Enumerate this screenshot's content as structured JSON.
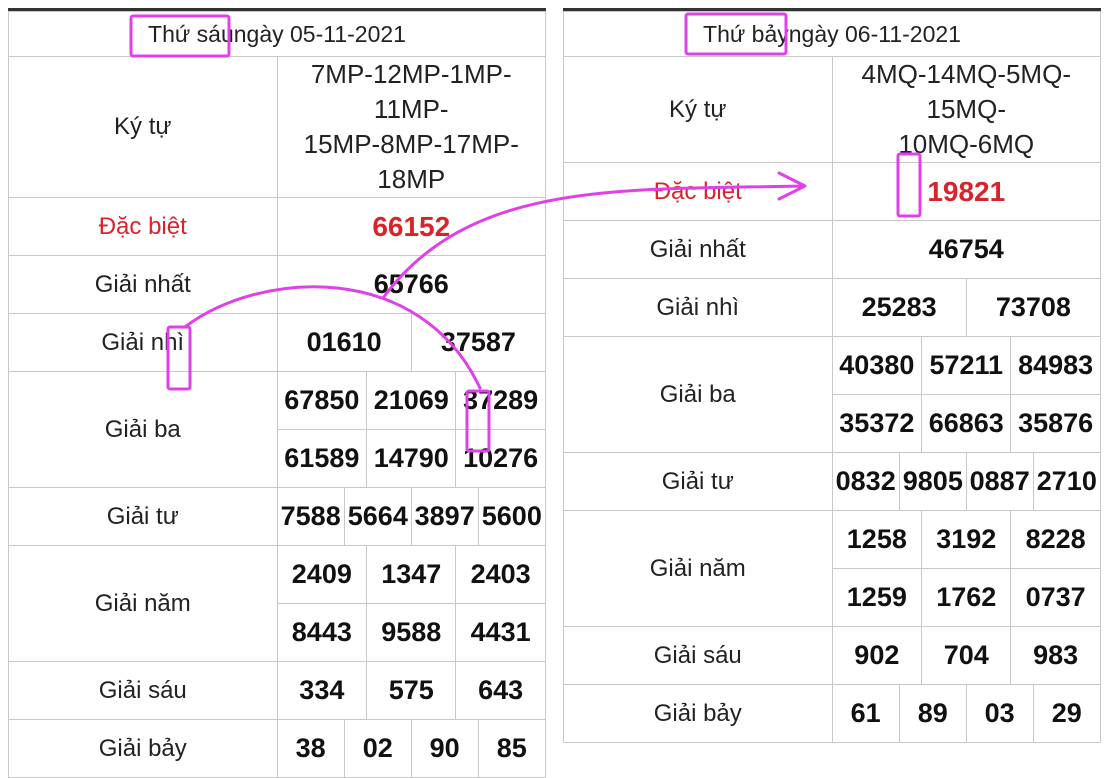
{
  "left": {
    "header": {
      "day": "Thứ sáu",
      "date_text": "ngày 05-11-2021"
    },
    "ky_tu_label": "Ký tự",
    "ky_tu_line1": "7MP-12MP-1MP-11MP-",
    "ky_tu_line2": "15MP-8MP-17MP-18MP",
    "dac_biet_label": "Đặc biệt",
    "dac_biet": "66152",
    "nhat_label": "Giải nhất",
    "nhat": "65766",
    "nhi_label": "Giải nhì",
    "nhi": [
      "01610",
      "37587"
    ],
    "ba_label": "Giải ba",
    "ba": [
      "67850",
      "21069",
      "37289",
      "61589",
      "14790",
      "10276"
    ],
    "tu_label": "Giải tư",
    "tu": [
      "7588",
      "5664",
      "3897",
      "5600"
    ],
    "nam_label": "Giải năm",
    "nam": [
      "2409",
      "1347",
      "2403",
      "8443",
      "9588",
      "4431"
    ],
    "sau_label": "Giải sáu",
    "sau": [
      "334",
      "575",
      "643"
    ],
    "bay_label": "Giải bảy",
    "bay": [
      "38",
      "02",
      "90",
      "85"
    ]
  },
  "right": {
    "header": {
      "day": "Thứ bảy",
      "date_text": "ngày 06-11-2021"
    },
    "ky_tu_label": "Ký tự",
    "ky_tu_line1": "4MQ-14MQ-5MQ-15MQ-",
    "ky_tu_line2": "10MQ-6MQ",
    "dac_biet_label": "Đặc biệt",
    "dac_biet": "19821",
    "nhat_label": "Giải nhất",
    "nhat": "46754",
    "nhi_label": "Giải nhì",
    "nhi": [
      "25283",
      "73708"
    ],
    "ba_label": "Giải ba",
    "ba": [
      "40380",
      "57211",
      "84983",
      "35372",
      "66863",
      "35876"
    ],
    "tu_label": "Giải tư",
    "tu": [
      "0832",
      "9805",
      "0887",
      "2710"
    ],
    "nam_label": "Giải năm",
    "nam": [
      "1258",
      "3192",
      "8228",
      "1259",
      "1762",
      "0737"
    ],
    "sau_label": "Giải sáu",
    "sau": [
      "902",
      "704",
      "983"
    ],
    "bay_label": "Giải bảy",
    "bay": [
      "61",
      "89",
      "03",
      "29"
    ]
  },
  "colors": {
    "special": "#d8232a",
    "annotation": "#e040e8",
    "border": "#c8c8c8"
  }
}
